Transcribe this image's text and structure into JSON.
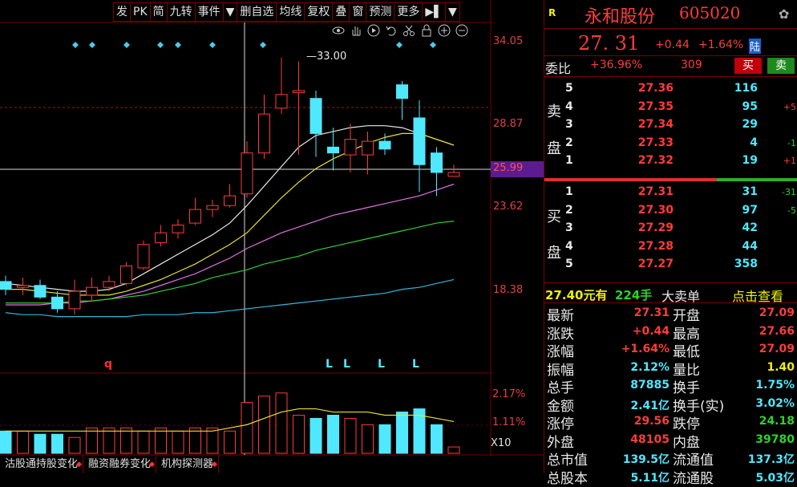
{
  "toolbar": {
    "buttons": [
      "发",
      "PK",
      "简",
      "九转",
      "事件",
      "▼",
      "删自选",
      "均线",
      "复权",
      "叠",
      "窗",
      "预测",
      "更多",
      "▶▌",
      "▼"
    ]
  },
  "chart": {
    "price_ticks": [
      "34.05",
      "28.87",
      "23.62",
      "18.38"
    ],
    "current_marker": "25.99",
    "peak_label": "33.00",
    "volume_ticks": [
      "2.17%",
      "1.11%"
    ],
    "volume_unit": "X10",
    "q_marker": "q",
    "l_markers": [
      "L",
      "L",
      "L",
      "L"
    ],
    "icons": [
      "eye-icon",
      "hand-icon",
      "play-icon",
      "undo-icon",
      "scissors-icon",
      "lock-icon",
      "zoom-in-icon",
      "zoom-out-icon"
    ]
  },
  "chart_data": {
    "type": "candlestick",
    "candles": [
      {
        "o": 21.7,
        "h": 22.0,
        "l": 21.0,
        "c": 21.3
      },
      {
        "o": 21.4,
        "h": 21.9,
        "l": 21.0,
        "c": 21.5
      },
      {
        "o": 21.5,
        "h": 21.8,
        "l": 20.8,
        "c": 20.9
      },
      {
        "o": 20.9,
        "h": 21.2,
        "l": 20.1,
        "c": 20.3
      },
      {
        "o": 20.3,
        "h": 21.8,
        "l": 20.0,
        "c": 21.2
      },
      {
        "o": 21.0,
        "h": 21.9,
        "l": 20.7,
        "c": 21.4
      },
      {
        "o": 21.4,
        "h": 22.0,
        "l": 21.2,
        "c": 21.7
      },
      {
        "o": 21.6,
        "h": 22.7,
        "l": 21.5,
        "c": 22.5
      },
      {
        "o": 22.4,
        "h": 23.8,
        "l": 22.3,
        "c": 23.6
      },
      {
        "o": 23.7,
        "h": 24.6,
        "l": 23.5,
        "c": 24.2
      },
      {
        "o": 24.2,
        "h": 24.9,
        "l": 23.9,
        "c": 24.6
      },
      {
        "o": 24.7,
        "h": 26.0,
        "l": 24.6,
        "c": 25.4
      },
      {
        "o": 25.4,
        "h": 25.9,
        "l": 25.0,
        "c": 25.6
      },
      {
        "o": 25.6,
        "h": 26.7,
        "l": 25.5,
        "c": 26.1
      },
      {
        "o": 26.2,
        "h": 28.9,
        "l": 26.0,
        "c": 28.3
      },
      {
        "o": 28.3,
        "h": 31.3,
        "l": 28.0,
        "c": 30.3
      },
      {
        "o": 30.6,
        "h": 33.2,
        "l": 30.3,
        "c": 31.3
      },
      {
        "o": 31.4,
        "h": 33.0,
        "l": 28.2,
        "c": 31.5
      },
      {
        "o": 31.1,
        "h": 31.5,
        "l": 28.1,
        "c": 29.3
      },
      {
        "o": 28.6,
        "h": 29.6,
        "l": 27.4,
        "c": 28.3
      },
      {
        "o": 28.2,
        "h": 29.8,
        "l": 27.3,
        "c": 29.0
      },
      {
        "o": 28.2,
        "h": 29.4,
        "l": 27.2,
        "c": 28.9
      },
      {
        "o": 28.9,
        "h": 29.3,
        "l": 28.2,
        "c": 28.5
      },
      {
        "o": 31.8,
        "h": 32.0,
        "l": 30.0,
        "c": 31.1
      },
      {
        "o": 30.1,
        "h": 31.0,
        "l": 26.3,
        "c": 27.7
      },
      {
        "o": 28.3,
        "h": 28.6,
        "l": 26.1,
        "c": 27.3
      },
      {
        "o": 27.1,
        "h": 27.7,
        "l": 27.1,
        "c": 27.3
      }
    ],
    "ma": {
      "white": [
        21.6,
        21.5,
        21.4,
        21.3,
        21.2,
        21.2,
        21.3,
        21.6,
        22.1,
        22.6,
        23.1,
        23.6,
        24.1,
        24.7,
        25.6,
        26.6,
        27.6,
        28.6,
        29.2,
        29.4,
        29.6,
        29.7,
        29.7,
        29.6,
        29.3,
        29.0,
        28.7
      ],
      "yellow": [
        21.3,
        21.3,
        21.2,
        21.1,
        21.0,
        21.0,
        21.0,
        21.2,
        21.5,
        21.8,
        22.2,
        22.6,
        23.1,
        23.6,
        24.2,
        25.1,
        26.0,
        26.8,
        27.5,
        28.0,
        28.4,
        28.8,
        29.1,
        29.3,
        29.3,
        29.0,
        28.7
      ],
      "magenta": [
        20.5,
        20.5,
        20.5,
        20.6,
        20.6,
        20.7,
        20.8,
        21.0,
        21.2,
        21.5,
        21.8,
        22.1,
        22.5,
        22.9,
        23.4,
        23.8,
        24.2,
        24.5,
        24.8,
        25.1,
        25.3,
        25.5,
        25.7,
        25.9,
        26.1,
        26.4,
        26.7
      ],
      "green": [
        20.6,
        20.6,
        20.6,
        20.6,
        20.7,
        20.7,
        20.8,
        20.9,
        21.0,
        21.2,
        21.4,
        21.6,
        21.9,
        22.1,
        22.3,
        22.6,
        22.8,
        23.0,
        23.3,
        23.5,
        23.7,
        23.9,
        24.1,
        24.3,
        24.5,
        24.7,
        24.8
      ],
      "cyan": [
        20.1,
        20.0,
        20.0,
        19.9,
        19.9,
        19.9,
        19.9,
        19.9,
        20.0,
        20.0,
        20.0,
        20.1,
        20.1,
        20.2,
        20.3,
        20.4,
        20.5,
        20.6,
        20.7,
        20.8,
        20.9,
        21.0,
        21.1,
        21.3,
        21.4,
        21.6,
        21.8
      ]
    },
    "volume_pct": [
      0.7,
      0.7,
      0.6,
      0.6,
      0.5,
      0.8,
      0.8,
      0.8,
      0.7,
      0.8,
      0.7,
      0.8,
      0.8,
      0.7,
      1.6,
      1.8,
      1.9,
      1.2,
      1.1,
      1.2,
      1.1,
      0.9,
      0.9,
      1.3,
      1.4,
      0.9,
      0.2
    ],
    "volume_ma": [
      0.7,
      0.7,
      0.7,
      0.7,
      0.7,
      0.7,
      0.7,
      0.7,
      0.7,
      0.7,
      0.7,
      0.7,
      0.7,
      0.8,
      0.9,
      1.1,
      1.3,
      1.4,
      1.4,
      1.3,
      1.3,
      1.3,
      1.2,
      1.2,
      1.2,
      1.1,
      1.0
    ],
    "ylim": [
      17.0,
      35.0
    ],
    "volume_ylim": [
      0,
      2.4
    ]
  },
  "panel": {
    "badge": "R",
    "stock_name": "永和股份",
    "stock_code": "605020",
    "price": "27. 31",
    "change": "+0.44",
    "change_pct": "+1.64%",
    "board_tag": "陆",
    "weibi_label": "委比",
    "weibi_value": "+36.96%",
    "weibi_diff": "309",
    "buy_btn": "买",
    "sell_btn": "卖",
    "sell_label": [
      "卖",
      "盘"
    ],
    "buy_label": [
      "买",
      "盘"
    ],
    "asks": [
      {
        "lvl": "5",
        "price": "27.36",
        "vol": "116",
        "chg": ""
      },
      {
        "lvl": "4",
        "price": "27.35",
        "vol": "95",
        "chg": "+5"
      },
      {
        "lvl": "3",
        "price": "27.34",
        "vol": "29",
        "chg": ""
      },
      {
        "lvl": "2",
        "price": "27.33",
        "vol": "4",
        "chg": "-1"
      },
      {
        "lvl": "1",
        "price": "27.32",
        "vol": "19",
        "chg": "+1"
      }
    ],
    "bids": [
      {
        "lvl": "1",
        "price": "27.31",
        "vol": "31",
        "chg": "-31"
      },
      {
        "lvl": "2",
        "price": "27.30",
        "vol": "97",
        "chg": "-5"
      },
      {
        "lvl": "3",
        "price": "27.29",
        "vol": "42",
        "chg": ""
      },
      {
        "lvl": "4",
        "price": "27.28",
        "vol": "44",
        "chg": ""
      },
      {
        "lvl": "5",
        "price": "27.27",
        "vol": "358",
        "chg": ""
      }
    ],
    "big_order": {
      "price": "27.40元有",
      "qty": "224手",
      "label": "大卖单",
      "link": "点击查看"
    },
    "stats": [
      {
        "k1": "最新",
        "v1": "27.31",
        "c1": "red",
        "k2": "开盘",
        "v2": "27.09",
        "c2": "red"
      },
      {
        "k1": "涨跌",
        "v1": "+0.44",
        "c1": "red",
        "k2": "最高",
        "v2": "27.66",
        "c2": "red"
      },
      {
        "k1": "涨幅",
        "v1": "+1.64%",
        "c1": "red",
        "k2": "最低",
        "v2": "27.09",
        "c2": "red"
      },
      {
        "k1": "振幅",
        "v1": "2.12%",
        "c1": "cyan",
        "k2": "量比",
        "v2": "1.40",
        "c2": "yellow"
      },
      {
        "k1": "总手",
        "v1": "87885",
        "c1": "cyan",
        "k2": "换手",
        "v2": "1.75%",
        "c2": "cyan"
      },
      {
        "k1": "金额",
        "v1": "2.41亿",
        "c1": "cyan",
        "k2": "换手(实)",
        "v2": "3.02%",
        "c2": "cyan"
      },
      {
        "k1": "涨停",
        "v1": "29.56",
        "c1": "red",
        "k2": "跌停",
        "v2": "24.18",
        "c2": "green"
      },
      {
        "k1": "外盘",
        "v1": "48105",
        "c1": "red",
        "k2": "内盘",
        "v2": "39780",
        "c2": "green"
      },
      {
        "k1": "总市值",
        "v1": "139.5亿",
        "c1": "cyan",
        "k2": "流通值",
        "v2": "137.3亿",
        "c2": "cyan"
      },
      {
        "k1": "总股本",
        "v1": "5.11亿",
        "c1": "cyan",
        "k2": "流通股",
        "v2": "5.03亿",
        "c2": "cyan"
      }
    ]
  },
  "bottom_tabs": [
    "沽股通持股变化",
    "融资融券变化",
    "机构探测器"
  ],
  "colors": {
    "up": "#ff3b3b",
    "down": "#4fe8ff",
    "grid": "#7a0000",
    "accent_purple": "#6a2aa0"
  }
}
